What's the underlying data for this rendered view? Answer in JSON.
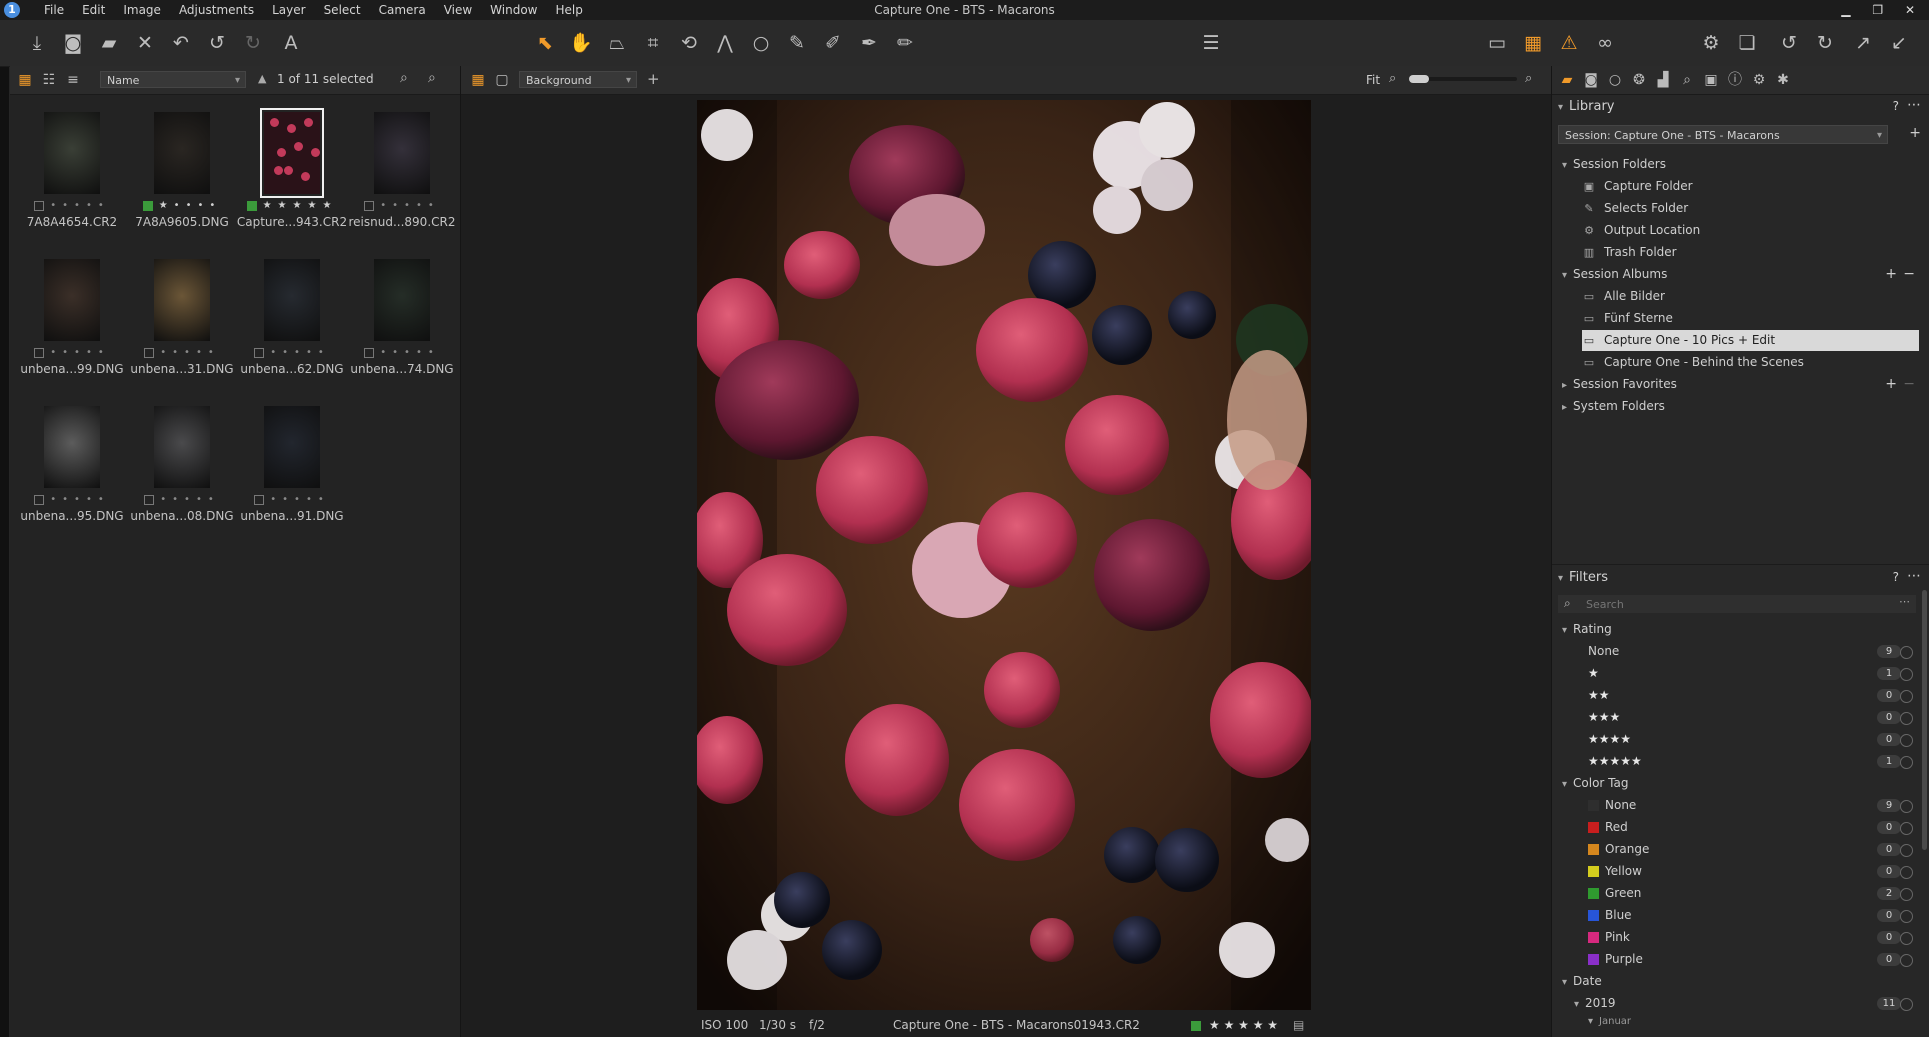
{
  "window": {
    "title": "Capture One - BTS - Macarons",
    "app_icon": "1",
    "menus": [
      "File",
      "Edit",
      "Image",
      "Adjustments",
      "Layer",
      "Select",
      "Camera",
      "View",
      "Window",
      "Help"
    ]
  },
  "browser": {
    "sort_field": "Name",
    "selection_count": "1 of 11 selected",
    "thumbnails": [
      {
        "name": "7A8A4654.CR2",
        "rating": 0,
        "color": "none",
        "selected": false,
        "tone": "#3a3f36"
      },
      {
        "name": "7A8A9605.DNG",
        "rating": 1,
        "color": "green",
        "selected": false,
        "tone": "#2a2622"
      },
      {
        "name": "Capture...943.CR2",
        "rating": 5,
        "color": "green",
        "selected": true,
        "tone": "#3a1d22"
      },
      {
        "name": "reisnud...890.CR2",
        "rating": 0,
        "color": "none",
        "selected": false,
        "tone": "#34303a"
      },
      {
        "name": "unbena...99.DNG",
        "rating": 0,
        "color": "none",
        "selected": false,
        "tone": "#3b2f28"
      },
      {
        "name": "unbena...31.DNG",
        "rating": 0,
        "color": "none",
        "selected": false,
        "tone": "#6b5637"
      },
      {
        "name": "unbena...62.DNG",
        "rating": 0,
        "color": "none",
        "selected": false,
        "tone": "#262a30"
      },
      {
        "name": "unbena...74.DNG",
        "rating": 0,
        "color": "none",
        "selected": false,
        "tone": "#252d27"
      },
      {
        "name": "unbena...95.DNG",
        "rating": 0,
        "color": "none",
        "selected": false,
        "tone": "#5c5c5c"
      },
      {
        "name": "unbena...08.DNG",
        "rating": 0,
        "color": "none",
        "selected": false,
        "tone": "#4a4a4c"
      },
      {
        "name": "unbena...91.DNG",
        "rating": 0,
        "color": "none",
        "selected": false,
        "tone": "#22262e"
      }
    ]
  },
  "viewer": {
    "background_select": "Background",
    "zoom_label": "Fit",
    "footer": {
      "iso": "ISO 100",
      "shutter": "1/30 s",
      "aperture": "f/2",
      "filename": "Capture One - BTS - Macarons01943.CR2",
      "rating": "★ ★ ★ ★ ★"
    }
  },
  "library": {
    "title": "Library",
    "session_select": "Session: Capture One - BTS - Macarons",
    "session_folders": {
      "label": "Session Folders",
      "items": [
        "Capture Folder",
        "Selects Folder",
        "Output Location",
        "Trash Folder"
      ]
    },
    "session_albums": {
      "label": "Session Albums",
      "items": [
        "Alle Bilder",
        "Fünf Sterne",
        "Capture One - 10 Pics + Edit",
        "Capture One - Behind the Scenes"
      ],
      "selected_index": 2
    },
    "session_favorites": "Session Favorites",
    "system_folders": "System Folders"
  },
  "filters": {
    "title": "Filters",
    "search_placeholder": "Search",
    "rating": {
      "label": "Rating",
      "items": [
        {
          "label": "None",
          "count": "9"
        },
        {
          "label": "★",
          "count": "1"
        },
        {
          "label": "★★",
          "count": "0"
        },
        {
          "label": "★★★",
          "count": "0"
        },
        {
          "label": "★★★★",
          "count": "0"
        },
        {
          "label": "★★★★★",
          "count": "1"
        }
      ]
    },
    "color_tag": {
      "label": "Color Tag",
      "items": [
        {
          "label": "None",
          "count": "9",
          "color": "#2e2e2e"
        },
        {
          "label": "Red",
          "count": "0",
          "color": "#c81e1e"
        },
        {
          "label": "Orange",
          "count": "0",
          "color": "#d5871e"
        },
        {
          "label": "Yellow",
          "count": "0",
          "color": "#d4cc1e"
        },
        {
          "label": "Green",
          "count": "2",
          "color": "#2f9a2f"
        },
        {
          "label": "Blue",
          "count": "0",
          "color": "#2755d8"
        },
        {
          "label": "Pink",
          "count": "0",
          "color": "#d6297f"
        },
        {
          "label": "Purple",
          "count": "0",
          "color": "#8a2fc9"
        }
      ]
    },
    "date": {
      "label": "Date",
      "year": "2019",
      "year_count": "11",
      "month": "Januar"
    }
  },
  "colors": {
    "accent": "#f09a2a",
    "selection": "#d9d9d9",
    "green_tag": "#3b9b3b"
  }
}
